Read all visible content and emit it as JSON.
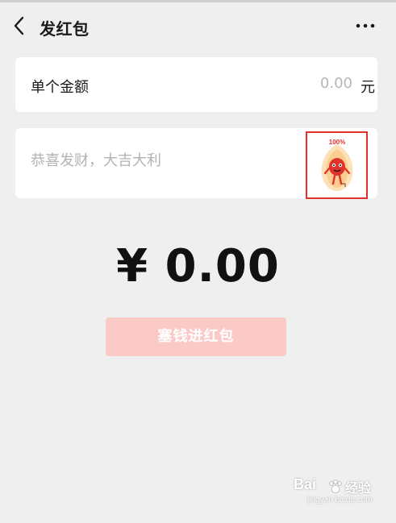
{
  "header": {
    "title": "发红包",
    "back_icon": "chevron-left-icon",
    "more_icon": "more-dots-icon"
  },
  "amount": {
    "label": "单个金额",
    "placeholder": "0.00",
    "unit": "元"
  },
  "greeting": {
    "placeholder": "恭喜发财，大吉大利",
    "sticker_icon": "red-packet-cover-sticker-icon",
    "sticker_badge": "100%"
  },
  "total": {
    "display": "¥ 0.00"
  },
  "submit": {
    "label": "塞钱进红包"
  },
  "watermark": {
    "brand": "Bai",
    "name": "经验",
    "url": "jingyan.baidu.com"
  },
  "colors": {
    "background": "#efefef",
    "card": "#ffffff",
    "button_disabled": "#fbc9c6",
    "highlight_border": "#e0312c"
  }
}
